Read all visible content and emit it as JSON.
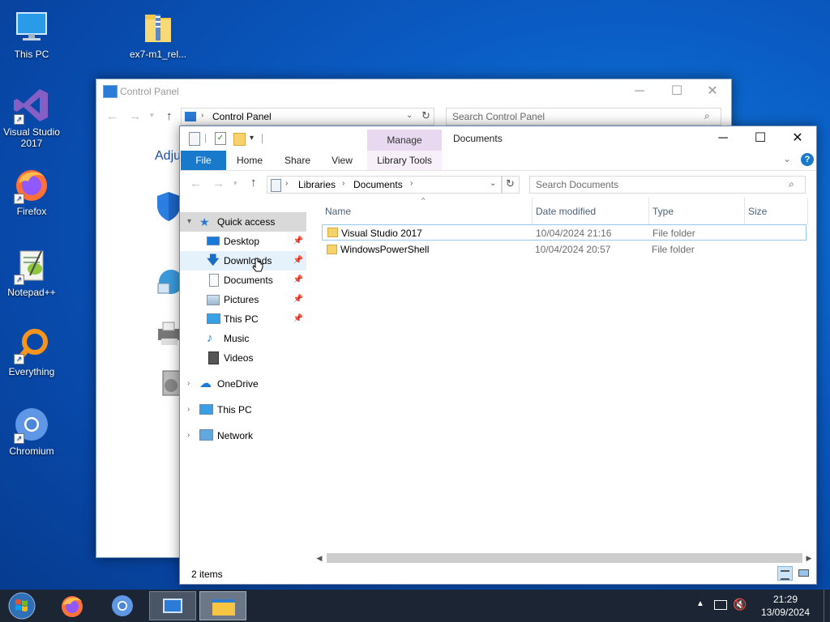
{
  "desktop": {
    "icons": [
      {
        "label": "This PC"
      },
      {
        "label": "ex7-m1_rel..."
      },
      {
        "label": "Visual Studio 2017"
      },
      {
        "label": "Firefox"
      },
      {
        "label": "Notepad++"
      },
      {
        "label": "Everything"
      },
      {
        "label": "Chromium"
      }
    ]
  },
  "control_panel": {
    "title": "Control Panel",
    "breadcrumb": "Control Panel",
    "search_placeholder": "Search Control Panel",
    "partial_heading": "Adju"
  },
  "explorer": {
    "title": "Documents",
    "quick_access_toolbar_sep": "|",
    "contextual_group": "Manage",
    "tabs": {
      "file": "File",
      "home": "Home",
      "share": "Share",
      "view": "View",
      "library_tools": "Library Tools"
    },
    "breadcrumb": [
      "Libraries",
      "Documents"
    ],
    "search_placeholder": "Search Documents",
    "nav": {
      "quick_access": "Quick access",
      "quick_items": [
        "Desktop",
        "Downloads",
        "Documents",
        "Pictures",
        "This PC",
        "Music",
        "Videos"
      ],
      "onedrive": "OneDrive",
      "this_pc": "This PC",
      "network": "Network"
    },
    "columns": {
      "name": "Name",
      "date": "Date modified",
      "type": "Type",
      "size": "Size"
    },
    "files": [
      {
        "name": "Visual Studio 2017",
        "date": "10/04/2024 21:16",
        "type": "File folder",
        "size": ""
      },
      {
        "name": "WindowsPowerShell",
        "date": "10/04/2024 20:57",
        "type": "File folder",
        "size": ""
      }
    ],
    "status": "2 items"
  },
  "taskbar": {
    "time": "21:29",
    "date": "13/09/2024"
  },
  "colors": {
    "accent": "#1979ca",
    "manage_tab": "#e8d8f0",
    "desktop_bg": "#0a5cc4",
    "taskbar": "#1b2533"
  }
}
